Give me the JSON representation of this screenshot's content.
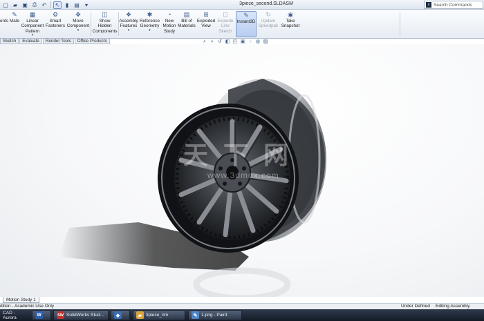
{
  "window": {
    "title": "3piece_second.SLDASM",
    "search_placeholder": "Search Commands"
  },
  "quick_access": [
    "new",
    "open",
    "save",
    "print",
    "undo",
    "select",
    "rebuild",
    "options"
  ],
  "ribbon": {
    "items": [
      {
        "id": "ents",
        "label": "ents",
        "icon": ""
      },
      {
        "id": "mate",
        "label": "Mate",
        "icon": "✎"
      },
      {
        "id": "linear-pattern",
        "label": "Linear Component Pattern",
        "icon": "▦",
        "dropdown": true
      },
      {
        "id": "smart-fasteners",
        "label": "Smart Fasteners",
        "icon": "⚙"
      },
      {
        "id": "move-component",
        "label": "Move Component",
        "icon": "✥",
        "dropdown": true
      },
      {
        "id": "show-hidden",
        "label": "Show Hidden Components",
        "icon": "◫"
      },
      {
        "id": "assembly-features",
        "label": "Assembly Features",
        "icon": "❖",
        "dropdown": true
      },
      {
        "id": "reference-geometry",
        "label": "Reference Geometry",
        "icon": "✱",
        "dropdown": true
      },
      {
        "id": "new-motion-study",
        "label": "New Motion Study",
        "icon": "◔"
      },
      {
        "id": "bill-of-materials",
        "label": "Bill of Materials",
        "icon": "▤"
      },
      {
        "id": "exploded-view",
        "label": "Exploded View",
        "icon": "⊞"
      },
      {
        "id": "explode-line-sketch",
        "label": "Explode Line Sketch",
        "icon": "⊡",
        "disabled": true
      },
      {
        "id": "instant3d",
        "label": "Instant3D",
        "icon": "✎",
        "active": true
      },
      {
        "id": "update-speedpak",
        "label": "Update Speedpak",
        "icon": "↻",
        "disabled": true
      },
      {
        "id": "take-snapshot",
        "label": "Take Snapshot",
        "icon": "◉"
      }
    ]
  },
  "tabs": [
    "Sketch",
    "Evaluate",
    "Render Tools",
    "Office Products"
  ],
  "heads_up_icons": [
    "zoom-fit",
    "zoom-area",
    "previous-view",
    "section-view",
    "view-orientation",
    "display-style",
    "hide-show",
    "edit-appearance",
    "apply-scene"
  ],
  "watermark": {
    "main": "天 下 网",
    "sub": "www.3dmox.com"
  },
  "motion_study_tab": "Motion Study 1",
  "status": {
    "left": "dition - Academic Use Only",
    "middle": "Under Defined",
    "right": "Editing Assembly"
  },
  "taskbar": [
    {
      "id": "cad-aurora",
      "label": "CAD - Aurora",
      "icon": "",
      "color": "#2e3a4d",
      "button": false
    },
    {
      "id": "word",
      "label": "",
      "icon": "W",
      "color": "#2a5cab",
      "button": true
    },
    {
      "id": "solidworks",
      "label": "SolidWorks Stud...",
      "icon": "SW",
      "color": "#c0312b",
      "button": true
    },
    {
      "id": "app4",
      "label": "",
      "icon": "◆",
      "color": "#3a6fb0",
      "button": true
    },
    {
      "id": "folder",
      "label": "3piece_rim",
      "icon": "▰",
      "color": "#d9a43a",
      "button": true
    },
    {
      "id": "paint",
      "label": "1.png - Paint",
      "icon": "✎",
      "color": "#4f86c6",
      "button": true
    }
  ]
}
